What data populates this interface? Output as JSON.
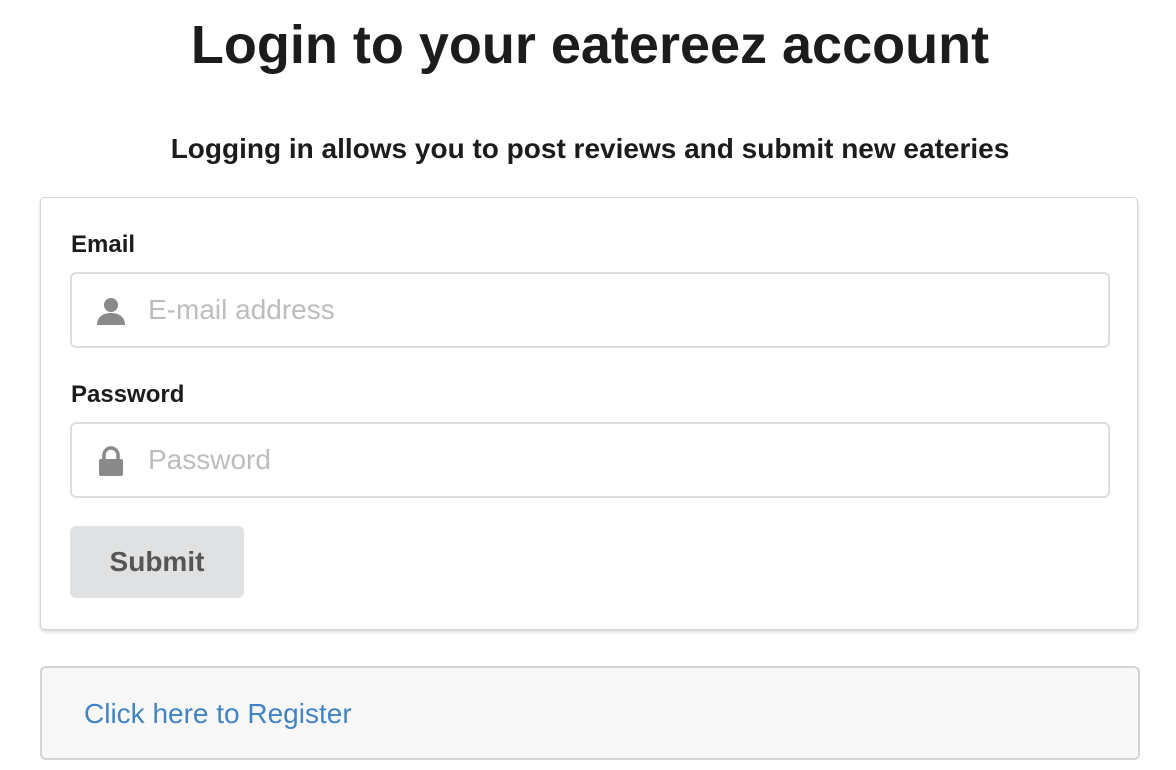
{
  "page": {
    "title": "Login to your eatereez account",
    "subtitle": "Logging in allows you to post reviews and submit new eateries"
  },
  "form": {
    "email_label": "Email",
    "email_placeholder": "E-mail address",
    "email_icon": "user-icon",
    "password_label": "Password",
    "password_placeholder": "Password",
    "password_icon": "lock-icon",
    "submit_label": "Submit"
  },
  "register": {
    "link_text": "Click here to Register"
  },
  "colors": {
    "link": "#4183c4",
    "button_bg": "#e0e1e2",
    "icon": "#8a8a8a"
  }
}
